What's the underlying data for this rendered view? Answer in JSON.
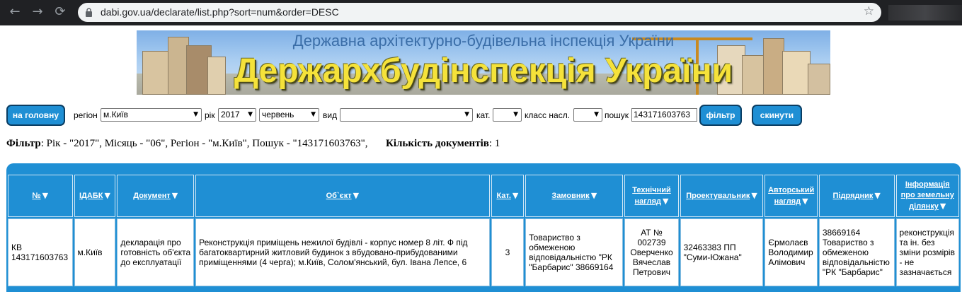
{
  "browser": {
    "url": "dabi.gov.ua/declarate/list.php?sort=num&order=DESC"
  },
  "banner": {
    "subtitle": "Державна архітектурно-будівельна інспекція України",
    "title": "Держархбудінспекція України"
  },
  "filters": {
    "home_label": "на головну",
    "region_label": "регіон",
    "region_value": "м.Київ",
    "year_label": "рік",
    "year_value": "2017",
    "month_value": "червень",
    "kind_label": "вид",
    "kind_value": "",
    "cat_label": "кат.",
    "cat_value": "",
    "class_label": "класс насл.",
    "class_value": "",
    "search_label": "пошук",
    "search_value": "143171603763",
    "filter_label": "фільтр",
    "reset_label": "скинути"
  },
  "summary": {
    "filter_label": "Фільтр",
    "filter_text": ": Рік - \"2017\", Місяць - \"06\", Регіон - \"м.Київ\", Пошук - \"143171603763\",",
    "count_label": "Кількість документів",
    "count_text": ": 1"
  },
  "table": {
    "columns": [
      "№",
      "ІДАБК",
      "Документ",
      "Об`єкт",
      "Кат.",
      "Замовник",
      "Технічний нагляд",
      "Проектувальник",
      "Авторський нагляд",
      "Підрядник",
      "Інформація про земельну ділянку"
    ],
    "rows": [
      {
        "num": "КВ 143171603763",
        "idabk": "м.Київ",
        "document": "декларація про готовність об'єкта до експлуатації",
        "object": "Реконструкція приміщень нежилої будівлі - корпус номер 8 літ. Ф під багатоквартирний житловий будинок з вбудовано-прибудованими приміщеннями (4 черга); м.Київ, Солом'янський, бул. Івана Лепсе, 6",
        "cat": "3",
        "customer": "Товариство з обмеженою відповідальністю \"РК \"Барбарис\" 38669164",
        "tech_supervision": "АТ № 002739 Оверченко Вячеслав Петрович",
        "designer": "32463383 ПП \"Суми-Южана\"",
        "author_supervision": "Єрмолаєв Володимир Алімович",
        "contractor": "38669164 Товариство з обмеженою відповідальністю \"РК \"Барбарис\"",
        "land_info": "реконструкція та ін. без зміни розмірів - не зазначається"
      }
    ]
  }
}
